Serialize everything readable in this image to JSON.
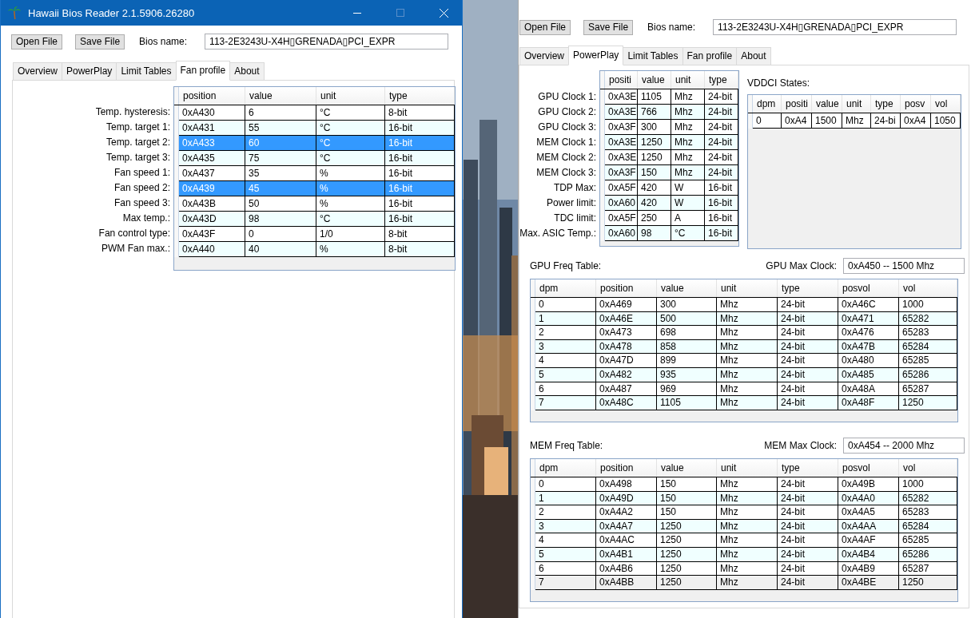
{
  "window_1": {
    "title": "Hawaii Bios Reader 2.1.5906.26280",
    "active": true,
    "toolbar": {
      "buttons": [
        "Open File",
        "Save File"
      ],
      "bios_label": "Bios name:",
      "bios_name": "113-2E3243U-X4H▯GRENADA▯PCI_EXPR"
    },
    "tabs": [
      {
        "label": "Overview",
        "selected": false
      },
      {
        "label": "PowerPlay",
        "selected": false
      },
      {
        "label": "Limit Tables",
        "selected": false
      },
      {
        "label": "Fan profile",
        "selected": true
      },
      {
        "label": "About",
        "selected": false
      }
    ],
    "fan_table": {
      "columns": [
        "position",
        "value",
        "unit",
        "type"
      ],
      "rows": [
        {
          "label": "Temp. hysteresis:",
          "cells": [
            "0xA430",
            "6",
            "°C",
            "8-bit"
          ],
          "selected": false
        },
        {
          "label": "Temp. target 1:",
          "cells": [
            "0xA431",
            "55",
            "°C",
            "16-bit"
          ],
          "selected": false
        },
        {
          "label": "Temp. target 2:",
          "cells": [
            "0xA433",
            "60",
            "°C",
            "16-bit"
          ],
          "selected": true
        },
        {
          "label": "Temp. target 3:",
          "cells": [
            "0xA435",
            "75",
            "°C",
            "16-bit"
          ],
          "selected": false
        },
        {
          "label": "Fan speed 1:",
          "cells": [
            "0xA437",
            "35",
            "%",
            "16-bit"
          ],
          "selected": false
        },
        {
          "label": "Fan speed 2:",
          "cells": [
            "0xA439",
            "45",
            "%",
            "16-bit"
          ],
          "selected": true
        },
        {
          "label": "Fan speed 3:",
          "cells": [
            "0xA43B",
            "50",
            "%",
            "16-bit"
          ],
          "selected": false
        },
        {
          "label": "Max temp.:",
          "cells": [
            "0xA43D",
            "98",
            "°C",
            "16-bit"
          ],
          "selected": false
        },
        {
          "label": "Fan control type:",
          "cells": [
            "0xA43F",
            "0",
            "1/0",
            "8-bit"
          ],
          "selected": false
        },
        {
          "label": "PWM Fan max.:",
          "cells": [
            "0xA440",
            "40",
            "%",
            "8-bit"
          ],
          "selected": false
        }
      ]
    }
  },
  "window_2": {
    "active": false,
    "toolbar": {
      "buttons": [
        "Open File",
        "Save File"
      ],
      "bios_label": "Bios name:",
      "bios_name": "113-2E3243U-X4H▯GRENADA▯PCI_EXPR"
    },
    "tabs": [
      {
        "label": "Overview",
        "selected": false
      },
      {
        "label": "PowerPlay",
        "selected": true
      },
      {
        "label": "Limit Tables",
        "selected": false
      },
      {
        "label": "Fan profile",
        "selected": false
      },
      {
        "label": "About",
        "selected": false
      }
    ],
    "clocks_table": {
      "columns": [
        "positi",
        "value",
        "unit",
        "type"
      ],
      "rows": [
        {
          "label": "GPU Clock 1:",
          "cells": [
            "0xA3E",
            "1105",
            "Mhz",
            "24-bit"
          ],
          "selected": false
        },
        {
          "label": "GPU Clock 2:",
          "cells": [
            "0xA3E",
            "766",
            "Mhz",
            "24-bit"
          ],
          "selected": false
        },
        {
          "label": "GPU Clock 3:",
          "cells": [
            "0xA3F",
            "300",
            "Mhz",
            "24-bit"
          ],
          "selected": false
        },
        {
          "label": "MEM Clock 1:",
          "cells": [
            "0xA3E",
            "1250",
            "Mhz",
            "24-bit"
          ],
          "selected": false
        },
        {
          "label": "MEM Clock 2:",
          "cells": [
            "0xA3E",
            "1250",
            "Mhz",
            "24-bit"
          ],
          "selected": false
        },
        {
          "label": "MEM Clock 3:",
          "cells": [
            "0xA3F",
            "150",
            "Mhz",
            "24-bit"
          ],
          "selected": false
        },
        {
          "label": "TDP Max:",
          "cells": [
            "0xA5F",
            "420",
            "W",
            "16-bit"
          ],
          "selected": false
        },
        {
          "label": "Power limit:",
          "cells": [
            "0xA60",
            "420",
            "W",
            "16-bit"
          ],
          "selected": false
        },
        {
          "label": "TDC limit:",
          "cells": [
            "0xA5F",
            "250",
            "A",
            "16-bit"
          ],
          "selected": false
        },
        {
          "label": "Max. ASIC Temp.:",
          "cells": [
            "0xA60",
            "98",
            "°C",
            "16-bit"
          ],
          "selected": false
        }
      ]
    },
    "vddci": {
      "title": "VDDCI States:",
      "columns": [
        "dpm",
        "positi",
        "value",
        "unit",
        "type",
        "posv",
        "vol"
      ],
      "rows": [
        {
          "cells": [
            "0",
            "0xA4",
            "1500",
            "Mhz",
            "24-bi",
            "0xA4",
            "1050"
          ],
          "selected": false
        }
      ]
    },
    "gpu_freq": {
      "title": "GPU Freq Table:",
      "max_clock_label": "GPU Max Clock:",
      "max_clock_value": "0xA450 -- 1500 Mhz",
      "columns": [
        "dpm",
        "position",
        "value",
        "unit",
        "type",
        "posvol",
        "vol"
      ],
      "rows": [
        {
          "cells": [
            "0",
            "0xA469",
            "300",
            "Mhz",
            "24-bit",
            "0xA46C",
            "1000"
          ],
          "selected": false
        },
        {
          "cells": [
            "1",
            "0xA46E",
            "500",
            "Mhz",
            "24-bit",
            "0xA471",
            "65282"
          ],
          "selected": false
        },
        {
          "cells": [
            "2",
            "0xA473",
            "698",
            "Mhz",
            "24-bit",
            "0xA476",
            "65283"
          ],
          "selected": false
        },
        {
          "cells": [
            "3",
            "0xA478",
            "858",
            "Mhz",
            "24-bit",
            "0xA47B",
            "65284"
          ],
          "selected": false
        },
        {
          "cells": [
            "4",
            "0xA47D",
            "899",
            "Mhz",
            "24-bit",
            "0xA480",
            "65285"
          ],
          "selected": false
        },
        {
          "cells": [
            "5",
            "0xA482",
            "935",
            "Mhz",
            "24-bit",
            "0xA485",
            "65286"
          ],
          "selected": false
        },
        {
          "cells": [
            "6",
            "0xA487",
            "969",
            "Mhz",
            "24-bit",
            "0xA48A",
            "65287"
          ],
          "selected": false
        },
        {
          "cells": [
            "7",
            "0xA48C",
            "1105",
            "Mhz",
            "24-bit",
            "0xA48F",
            "1250"
          ],
          "selected": false
        }
      ]
    },
    "mem_freq": {
      "title": "MEM Freq Table:",
      "max_clock_label": "MEM Max Clock:",
      "max_clock_value": "0xA454 -- 2000 Mhz",
      "columns": [
        "dpm",
        "position",
        "value",
        "unit",
        "type",
        "posvol",
        "vol"
      ],
      "rows": [
        {
          "cells": [
            "0",
            "0xA498",
            "150",
            "Mhz",
            "24-bit",
            "0xA49B",
            "1000"
          ],
          "selected": false
        },
        {
          "cells": [
            "1",
            "0xA49D",
            "150",
            "Mhz",
            "24-bit",
            "0xA4A0",
            "65282"
          ],
          "selected": false
        },
        {
          "cells": [
            "2",
            "0xA4A2",
            "150",
            "Mhz",
            "24-bit",
            "0xA4A5",
            "65283"
          ],
          "selected": false
        },
        {
          "cells": [
            "3",
            "0xA4A7",
            "1250",
            "Mhz",
            "24-bit",
            "0xA4AA",
            "65284"
          ],
          "selected": false
        },
        {
          "cells": [
            "4",
            "0xA4AC",
            "1250",
            "Mhz",
            "24-bit",
            "0xA4AF",
            "65285"
          ],
          "selected": false
        },
        {
          "cells": [
            "5",
            "0xA4B1",
            "1250",
            "Mhz",
            "24-bit",
            "0xA4B4",
            "65286"
          ],
          "selected": false
        },
        {
          "cells": [
            "6",
            "0xA4B6",
            "1250",
            "Mhz",
            "24-bit",
            "0xA4B9",
            "65287"
          ],
          "selected": false
        },
        {
          "cells": [
            "7",
            "0xA4BB",
            "1250",
            "Mhz",
            "24-bit",
            "0xA4BE",
            "1250"
          ],
          "selected": true
        }
      ]
    }
  }
}
